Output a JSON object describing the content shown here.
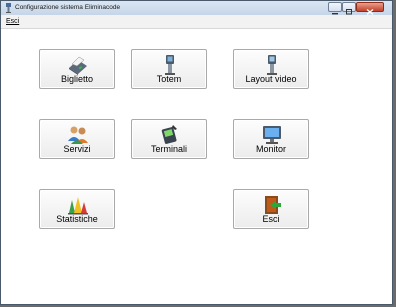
{
  "window": {
    "title": "Configurazione sistema Eliminacode",
    "icon": "app-totem-icon"
  },
  "menu": {
    "items": [
      {
        "label": "Esci"
      }
    ]
  },
  "tiles": [
    {
      "label": "Biglietto",
      "icon": "ticket-printer-icon"
    },
    {
      "label": "Totem",
      "icon": "totem-kiosk-icon"
    },
    {
      "label": "Layout video",
      "icon": "video-layout-kiosk-icon"
    },
    {
      "label": "Servizi",
      "icon": "users-services-icon"
    },
    {
      "label": "Terminali",
      "icon": "terminal-handheld-icon"
    },
    {
      "label": "Monitor",
      "icon": "monitor-icon"
    },
    {
      "label": "Statistiche",
      "icon": "statistics-chart-icon"
    },
    {
      "label": "Esci",
      "icon": "exit-door-icon"
    }
  ]
}
